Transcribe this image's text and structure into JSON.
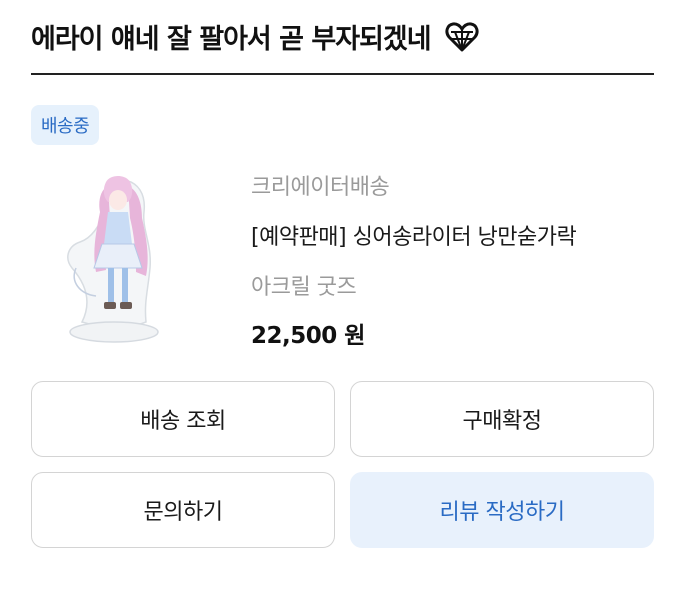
{
  "header": {
    "title": "에라이 얘네 잘 팔아서 곧 부자되겠네",
    "icon": "heart-icon"
  },
  "order": {
    "status_badge": "배송중",
    "seller": "크리에이터배송",
    "product_title": "[예약판매] 싱어송라이터 낭만숟가락",
    "option": "아크릴 굿즈",
    "price": "22,500 원"
  },
  "actions": {
    "track_delivery": "배송 조회",
    "confirm_purchase": "구매확정",
    "inquiry": "문의하기",
    "write_review": "리뷰 작성하기"
  },
  "colors": {
    "accent": "#2a6bc4",
    "badge_bg": "#e6f1fc",
    "muted_text": "#9a9a9a"
  }
}
